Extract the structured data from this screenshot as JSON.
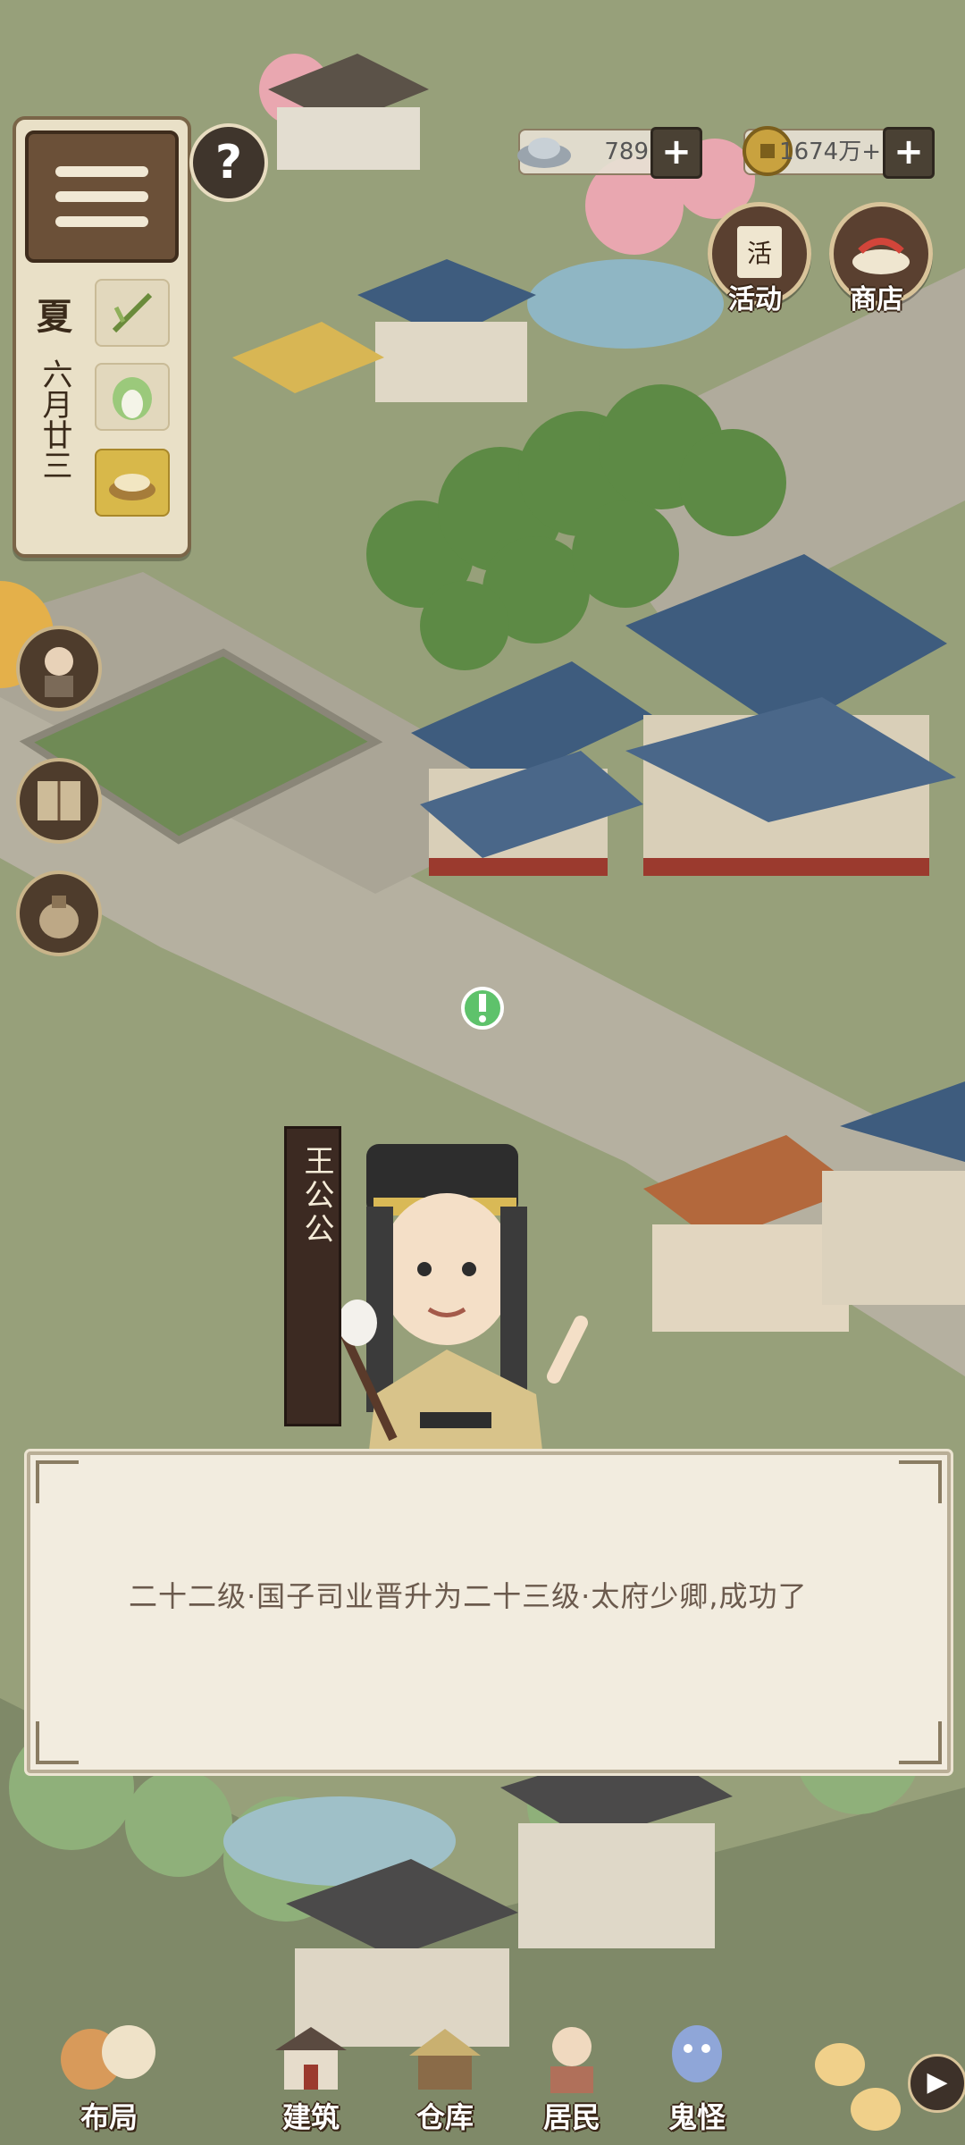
{
  "hud": {
    "season": "夏",
    "date": "六月廿三",
    "help_icon": "?",
    "currency": [
      {
        "name": "silver",
        "value": "789",
        "plus": "+"
      },
      {
        "name": "copper",
        "value": "1674万+",
        "plus": "+"
      }
    ],
    "activity_label": "活动",
    "activity_glyph": "活",
    "shop_label": "商店"
  },
  "dialog": {
    "speaker": "王公公",
    "text": "二十二级·国子司业晋升为二十三级·太府少卿,成功了"
  },
  "bottom_nav": {
    "items": [
      {
        "label": "布局"
      },
      {
        "label": "建筑"
      },
      {
        "label": "仓库"
      },
      {
        "label": "居民"
      },
      {
        "label": "鬼怪"
      }
    ],
    "more_icon": "▶"
  },
  "colors": {
    "grass": "#8f9a72",
    "road": "#b7b2a2",
    "roof_blue": "#3e5c7e",
    "panel": "#e9e0c7",
    "dialog_bg": "#f2ecdf"
  }
}
